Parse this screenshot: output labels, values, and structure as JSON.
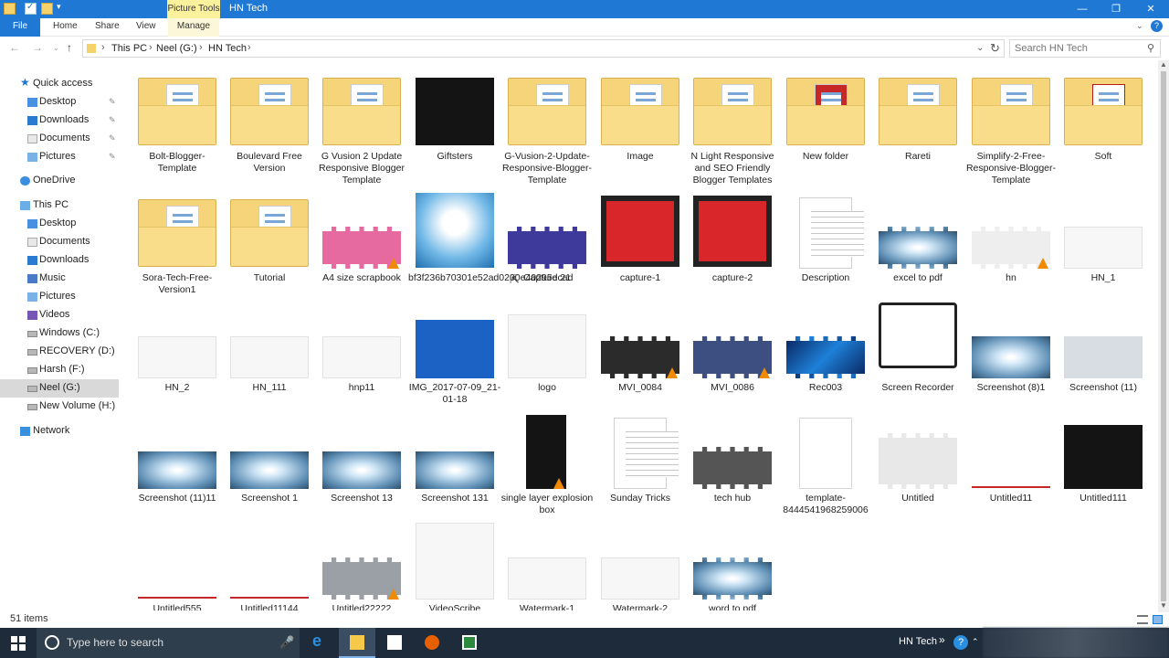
{
  "titlebar": {
    "picture_tools_label": "Picture Tools",
    "title": "HN Tech",
    "minimize_label": "—",
    "maximize_label": "❐",
    "close_label": "✕"
  },
  "ribbon": {
    "tabs": {
      "file": "File",
      "home": "Home",
      "share": "Share",
      "view": "View",
      "manage": "Manage"
    },
    "expand_label": "⌄",
    "help_label": "?"
  },
  "address": {
    "crumbs": [
      "This PC",
      "Neel (G:)",
      "HN Tech"
    ],
    "separator": "›",
    "search_placeholder": "Search HN Tech"
  },
  "nav_icons": {
    "back": "←",
    "forward": "→",
    "recent": "⌄",
    "up": "↑",
    "refresh": "↻",
    "search": "⚲",
    "pin": "✎"
  },
  "sidebar": {
    "quick_access": "Quick access",
    "quick_items": [
      "Desktop",
      "Downloads",
      "Documents",
      "Pictures"
    ],
    "onedrive": "OneDrive",
    "this_pc": "This PC",
    "pc_items": [
      "Desktop",
      "Documents",
      "Downloads",
      "Music",
      "Pictures",
      "Videos"
    ],
    "drives": [
      "Windows (C:)",
      "RECOVERY (D:)",
      "Harsh (F:)",
      "Neel (G:)",
      "New Volume (H:)"
    ],
    "network": "Network"
  },
  "files": [
    "Bolt-Blogger-Template",
    "Boulevard Free Version",
    "G Vusion 2 Update Responsive Blogger Template",
    "Giftsters",
    "G-Vusion-2-Update-Responsive-Blogger-Template",
    "Image",
    "N Light Responsive and SEO Friendly Blogger Templates",
    "New folder",
    "Rareti",
    "Simplify-2-Free-Responsive-Blogger-Template",
    "Soft",
    "Sora-Tech-Free-Version1",
    "Tutorial",
    "A4 size scrapbook",
    "bf3f236b70301e52ad0200e40295dcad",
    "Capture 21",
    "capture-1",
    "capture-2",
    "Description",
    "excel to pdf",
    "hn",
    "HN_1",
    "HN_2",
    "HN_111",
    "hnp11",
    "IMG_2017-07-09_21-01-18",
    "logo",
    "MVI_0084",
    "MVI_0086",
    "Rec003",
    "Screen Recorder",
    "Screenshot (8)1",
    "Screenshot (11)",
    "Screenshot (11)11",
    "Screenshot 1",
    "Screenshot 13",
    "Screenshot 131",
    "single layer explosion box",
    "Sunday Tricks",
    "tech hub",
    "template-8444541968259006",
    "Untitled",
    "Untitled11",
    "Untitled111",
    "Untitled555",
    "Untitled11144",
    "Untitled22222",
    "VideoScribe",
    "Watermark-1",
    "Watermark-2",
    "word to pdf"
  ],
  "status": {
    "item_count": "51 items"
  },
  "taskbar": {
    "search_placeholder": "Type here to search",
    "mic_icon": "🎤",
    "edge_glyph": "e",
    "tray_label": "HN Tech",
    "tray_chevron": "»",
    "tray_help": "?",
    "tray_expand": "⌃"
  },
  "colors": {
    "accent": "#1f78d4",
    "picture_tools": "#fbf19c",
    "taskbar": "#1d2b3a"
  }
}
